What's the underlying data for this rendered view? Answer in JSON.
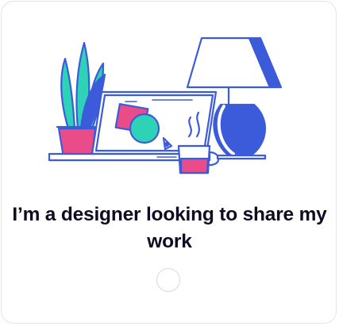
{
  "option": {
    "title": "I’m a designer looking to share my work",
    "selected": false
  },
  "illustration": {
    "name": "designer-desk-illustration",
    "colors": {
      "outline": "#3b5bdb",
      "pink": "#ea4c89",
      "teal": "#2ed3b7",
      "white": "#ffffff"
    }
  }
}
